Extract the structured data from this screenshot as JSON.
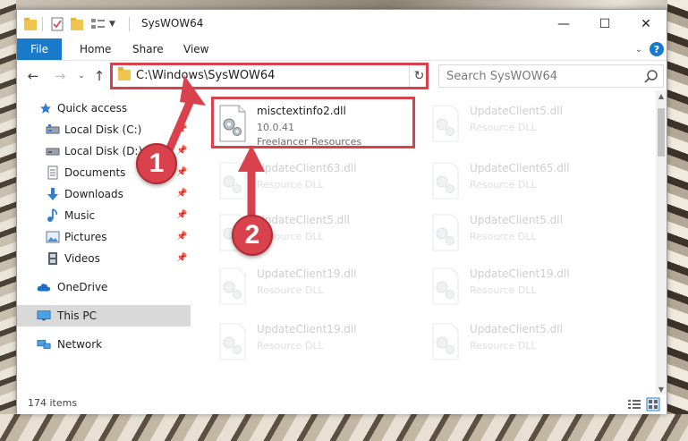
{
  "window": {
    "title": "SysWOW64",
    "controls": {
      "minimize": "—",
      "maximize": "☐",
      "close": "✕"
    }
  },
  "ribbon": {
    "tabs": [
      "File",
      "Home",
      "Share",
      "View"
    ],
    "help": "?"
  },
  "navigation": {
    "address_path": "C:\\Windows\\SysWOW64",
    "search_placeholder": "Search SysWOW64"
  },
  "sidebar": {
    "items": [
      {
        "label": "Quick access",
        "icon": "star-icon",
        "pinned": false
      },
      {
        "label": "Local Disk (C:)",
        "icon": "drive-icon",
        "pinned": true
      },
      {
        "label": "Local Disk (D:)",
        "icon": "drive-icon",
        "pinned": true
      },
      {
        "label": "Documents",
        "icon": "document-icon",
        "pinned": true
      },
      {
        "label": "Downloads",
        "icon": "download-arrow-icon",
        "pinned": true
      },
      {
        "label": "Music",
        "icon": "music-note-icon",
        "pinned": true
      },
      {
        "label": "Pictures",
        "icon": "picture-icon",
        "pinned": true
      },
      {
        "label": "Videos",
        "icon": "film-icon",
        "pinned": true
      },
      {
        "label": "OneDrive",
        "icon": "cloud-icon",
        "pinned": false
      },
      {
        "label": "This PC",
        "icon": "monitor-icon",
        "pinned": false,
        "selected": true
      },
      {
        "label": "Network",
        "icon": "network-icon",
        "pinned": false
      }
    ]
  },
  "files": [
    {
      "name": "misctextinfo2.dll",
      "version": "10.0.41",
      "company": "Freelancer Resources",
      "highlighted": true
    },
    {
      "name": "UpdateClient5.dll",
      "type": "Resource DLL"
    },
    {
      "name": "UpdateClient63.dll",
      "type": "Resource DLL"
    },
    {
      "name": "UpdateClient65.dll",
      "type": "Resource DLL"
    },
    {
      "name": "UpdateClient5.dll",
      "type": "Resource DLL"
    },
    {
      "name": "UpdateClient5.dll",
      "type": "Resource DLL"
    },
    {
      "name": "UpdateClient19.dll",
      "type": "Resource DLL"
    },
    {
      "name": "UpdateClient19.dll",
      "type": "Resource DLL"
    },
    {
      "name": "UpdateClient19.dll",
      "type": "Resource DLL"
    },
    {
      "name": "UpdateClient5.dll",
      "type": "Resource DLL"
    }
  ],
  "status": {
    "item_count": "174 items"
  },
  "annotations": {
    "step1": "1",
    "step2": "2"
  },
  "colors": {
    "accent": "#1979ca",
    "highlight": "#d9414c",
    "selected": "#d9d9d9"
  }
}
